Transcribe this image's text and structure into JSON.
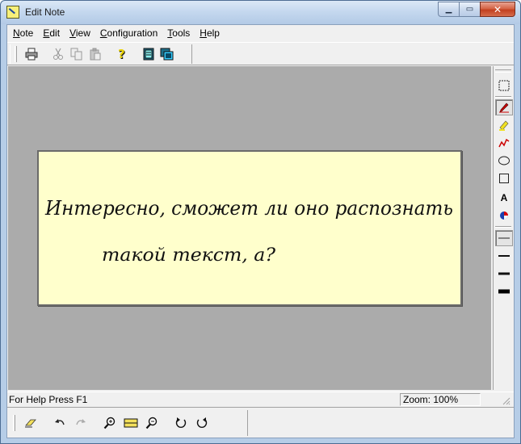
{
  "window": {
    "title": "Edit Note"
  },
  "caption": {
    "minimize_icon": "minimize-icon",
    "maximize_icon": "maximize-icon",
    "close_icon": "close-icon",
    "minimize_glyph": "▁",
    "maximize_glyph": "▭",
    "close_glyph": "✕"
  },
  "menu": [
    {
      "key": "N",
      "rest": "ote"
    },
    {
      "key": "E",
      "rest": "dit"
    },
    {
      "key": "V",
      "rest": "iew"
    },
    {
      "key": "C",
      "rest": "onfiguration"
    },
    {
      "key": "T",
      "rest": "ools"
    },
    {
      "key": "H",
      "rest": "elp"
    }
  ],
  "toolbar": {
    "buttons": [
      {
        "name": "print-button",
        "icon": "printer-icon",
        "enabled": true
      },
      {
        "name": "cut-button",
        "icon": "scissors-icon",
        "enabled": false
      },
      {
        "name": "copy-button",
        "icon": "copy-icon",
        "enabled": false
      },
      {
        "name": "paste-button",
        "icon": "paste-icon",
        "enabled": false
      },
      {
        "name": "help-button",
        "icon": "help-question-icon",
        "enabled": true
      },
      {
        "name": "note-view-button",
        "icon": "note-view-icon",
        "enabled": true
      },
      {
        "name": "multi-note-button",
        "icon": "multi-note-icon",
        "enabled": true
      }
    ]
  },
  "note": {
    "line1": "Интересно, сможет ли оно распознать",
    "line2": "такой текст, а?",
    "background": "#ffffcc",
    "ink_color": "#111111"
  },
  "right_tools": [
    {
      "name": "select-tool-button",
      "icon": "selection-rectangle-icon",
      "active": false
    },
    {
      "name": "pen-tool-button",
      "icon": "pen-icon",
      "active": true
    },
    {
      "name": "highlighter-tool-button",
      "icon": "highlighter-icon",
      "active": false
    },
    {
      "name": "freehand-tool-button",
      "icon": "freehand-line-icon",
      "active": false
    },
    {
      "name": "ellipse-tool-button",
      "icon": "ellipse-icon",
      "active": false
    },
    {
      "name": "rectangle-tool-button",
      "icon": "rectangle-icon",
      "active": false
    },
    {
      "name": "text-tool-button",
      "icon": "text-a-icon",
      "active": false
    },
    {
      "name": "color-tool-button",
      "icon": "color-palette-icon",
      "active": false
    },
    {
      "name": "line-width-1-button",
      "icon": "line-thin-icon",
      "active": true
    },
    {
      "name": "line-width-2-button",
      "icon": "line-medium-icon",
      "active": false
    },
    {
      "name": "line-width-3-button",
      "icon": "line-thick-icon",
      "active": false
    },
    {
      "name": "line-width-4-button",
      "icon": "line-thickest-icon",
      "active": false
    }
  ],
  "text_tool_label": "A",
  "status": {
    "help_text": "For Help Press F1",
    "zoom": "Zoom: 100%"
  },
  "bottom_toolbar": [
    {
      "name": "eraser-button",
      "icon": "eraser-icon",
      "enabled": true
    },
    {
      "name": "undo-button",
      "icon": "undo-icon",
      "enabled": true
    },
    {
      "name": "redo-button",
      "icon": "redo-icon",
      "enabled": false
    },
    {
      "name": "zoom-in-button",
      "icon": "zoom-in-icon",
      "enabled": true
    },
    {
      "name": "fit-page-button",
      "icon": "fit-page-icon",
      "enabled": true
    },
    {
      "name": "zoom-out-button",
      "icon": "zoom-out-icon",
      "enabled": true
    },
    {
      "name": "rotate-clockwise-button",
      "icon": "rotate-clockwise-icon",
      "enabled": true
    },
    {
      "name": "rotate-counterclockwise-button",
      "icon": "rotate-counterclockwise-icon",
      "enabled": true
    }
  ],
  "colors": {
    "canvas": "#ababab",
    "chrome": "#f0f0f0",
    "title_bar": "#c3d7ee",
    "close_button": "#c2401f"
  }
}
